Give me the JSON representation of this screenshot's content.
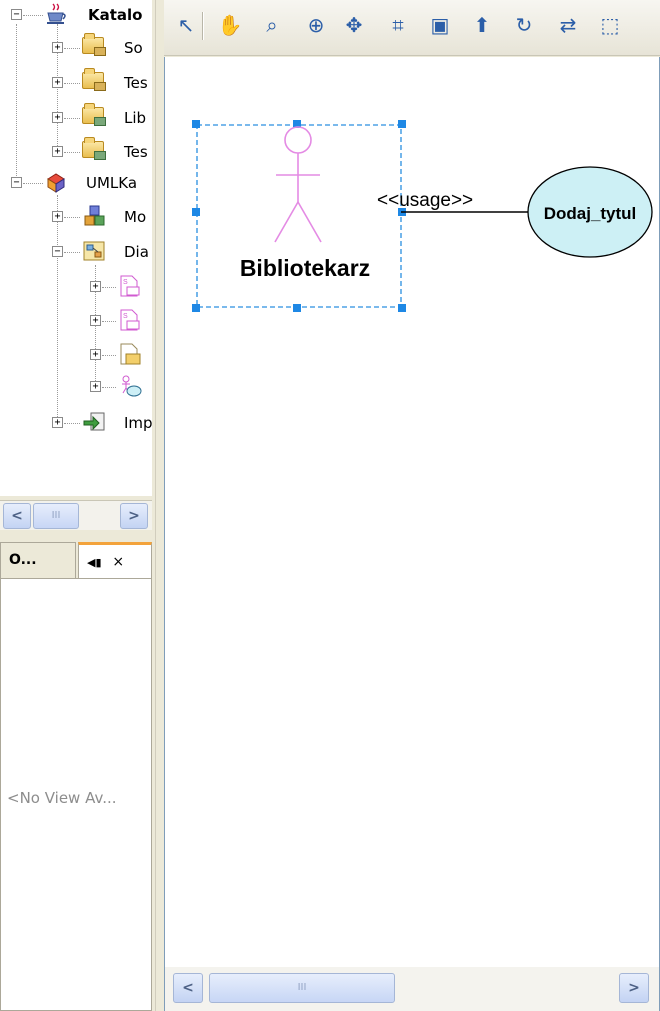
{
  "project_tree": {
    "nodes": [
      {
        "label": "Katalo",
        "icon": "coffee-cup-icon"
      },
      {
        "label": "So",
        "icon": "source-folder-icon"
      },
      {
        "label": "Tes",
        "icon": "test-folder-icon"
      },
      {
        "label": "Lib",
        "icon": "library-folder-icon"
      },
      {
        "label": "Tes",
        "icon": "test-library-folder-icon"
      },
      {
        "label": "UMLKa",
        "icon": "uml-project-icon"
      },
      {
        "label": "Mo",
        "icon": "model-icon"
      },
      {
        "label": "Dia",
        "icon": "diagrams-icon"
      },
      {
        "label": "",
        "icon": "sequence-diagram-icon"
      },
      {
        "label": "",
        "icon": "sequence-diagram-icon"
      },
      {
        "label": "",
        "icon": "folder-diagram-icon"
      },
      {
        "label": "",
        "icon": "use-case-diagram-icon"
      },
      {
        "label": "Imp",
        "icon": "imported-elements-icon"
      }
    ],
    "hscroll": {
      "left_arrow": "<",
      "right_arrow": ">",
      "thumb_grip": "III"
    }
  },
  "navigator": {
    "tabs": [
      {
        "label": "O..."
      },
      {
        "label": "◀▮"
      }
    ],
    "close_glyph": "×",
    "empty_text": "<No View Av..."
  },
  "editor": {
    "toolbar": [
      {
        "name": "select-icon",
        "glyph": "↖"
      },
      {
        "name": "pan-hand-icon",
        "glyph": "✋"
      },
      {
        "name": "zoom-icon",
        "glyph": "⌕"
      },
      {
        "name": "zoom-interactive-icon",
        "glyph": "⊕"
      },
      {
        "name": "move-icon",
        "glyph": "✥"
      },
      {
        "name": "overview-icon",
        "glyph": "⌗"
      },
      {
        "name": "layout-icon",
        "glyph": "▣"
      },
      {
        "name": "relationship-discovery-icon",
        "glyph": "⬆"
      },
      {
        "name": "refresh-icon",
        "glyph": "↻"
      },
      {
        "name": "navigate-icon",
        "glyph": "⇄"
      },
      {
        "name": "fit-to-window-icon",
        "glyph": "⬚"
      }
    ],
    "diagram": {
      "actor_name": "Bibliotekarz",
      "dependency_label": "<<usage>>",
      "use_case_name": "Dodaj_tytul"
    },
    "hscroll": {
      "left_arrow": "<",
      "right_arrow": ">",
      "thumb_grip": "III"
    }
  },
  "colors": {
    "actor_stroke": "#e48be4",
    "selection": "#2a8fe0",
    "use_case_fill": "#cdf0f5"
  }
}
